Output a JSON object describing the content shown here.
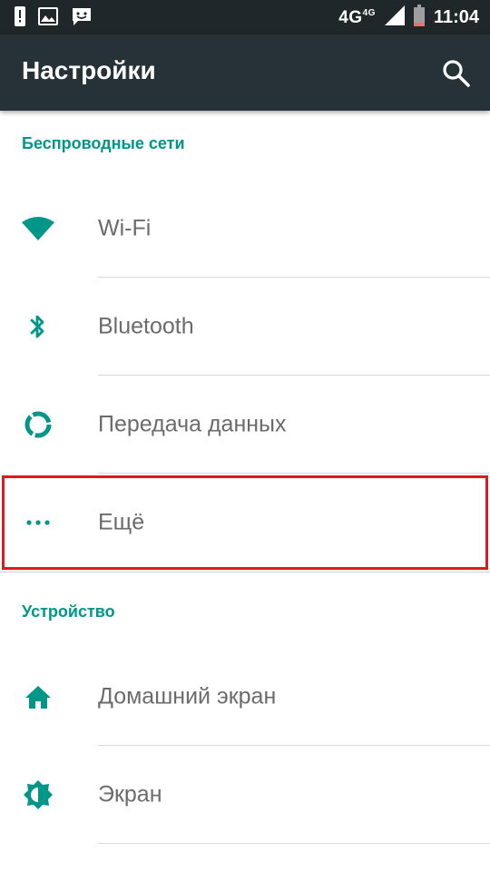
{
  "status_bar": {
    "network": "4G",
    "network_sup": "4G",
    "time": "11:04",
    "icons": [
      "alert-icon",
      "image-icon",
      "message-icon",
      "signal-icon",
      "battery-icon"
    ]
  },
  "app_bar": {
    "title": "Настройки",
    "search_icon": "search-icon"
  },
  "sections": [
    {
      "header": "Беспроводные сети",
      "items": [
        {
          "label": "Wi-Fi",
          "icon": "wifi-icon"
        },
        {
          "label": "Bluetooth",
          "icon": "bluetooth-icon"
        },
        {
          "label": "Передача данных",
          "icon": "data-usage-icon"
        },
        {
          "label": "Ещё",
          "icon": "more-dots-icon",
          "highlighted": true
        }
      ]
    },
    {
      "header": "Устройство",
      "items": [
        {
          "label": "Домашний экран",
          "icon": "home-icon"
        },
        {
          "label": "Экран",
          "icon": "brightness-icon"
        }
      ]
    }
  ],
  "colors": {
    "accent": "#009688",
    "app_bar": "#263238",
    "status_bar": "#1f272b",
    "highlight": "#e0191f"
  }
}
